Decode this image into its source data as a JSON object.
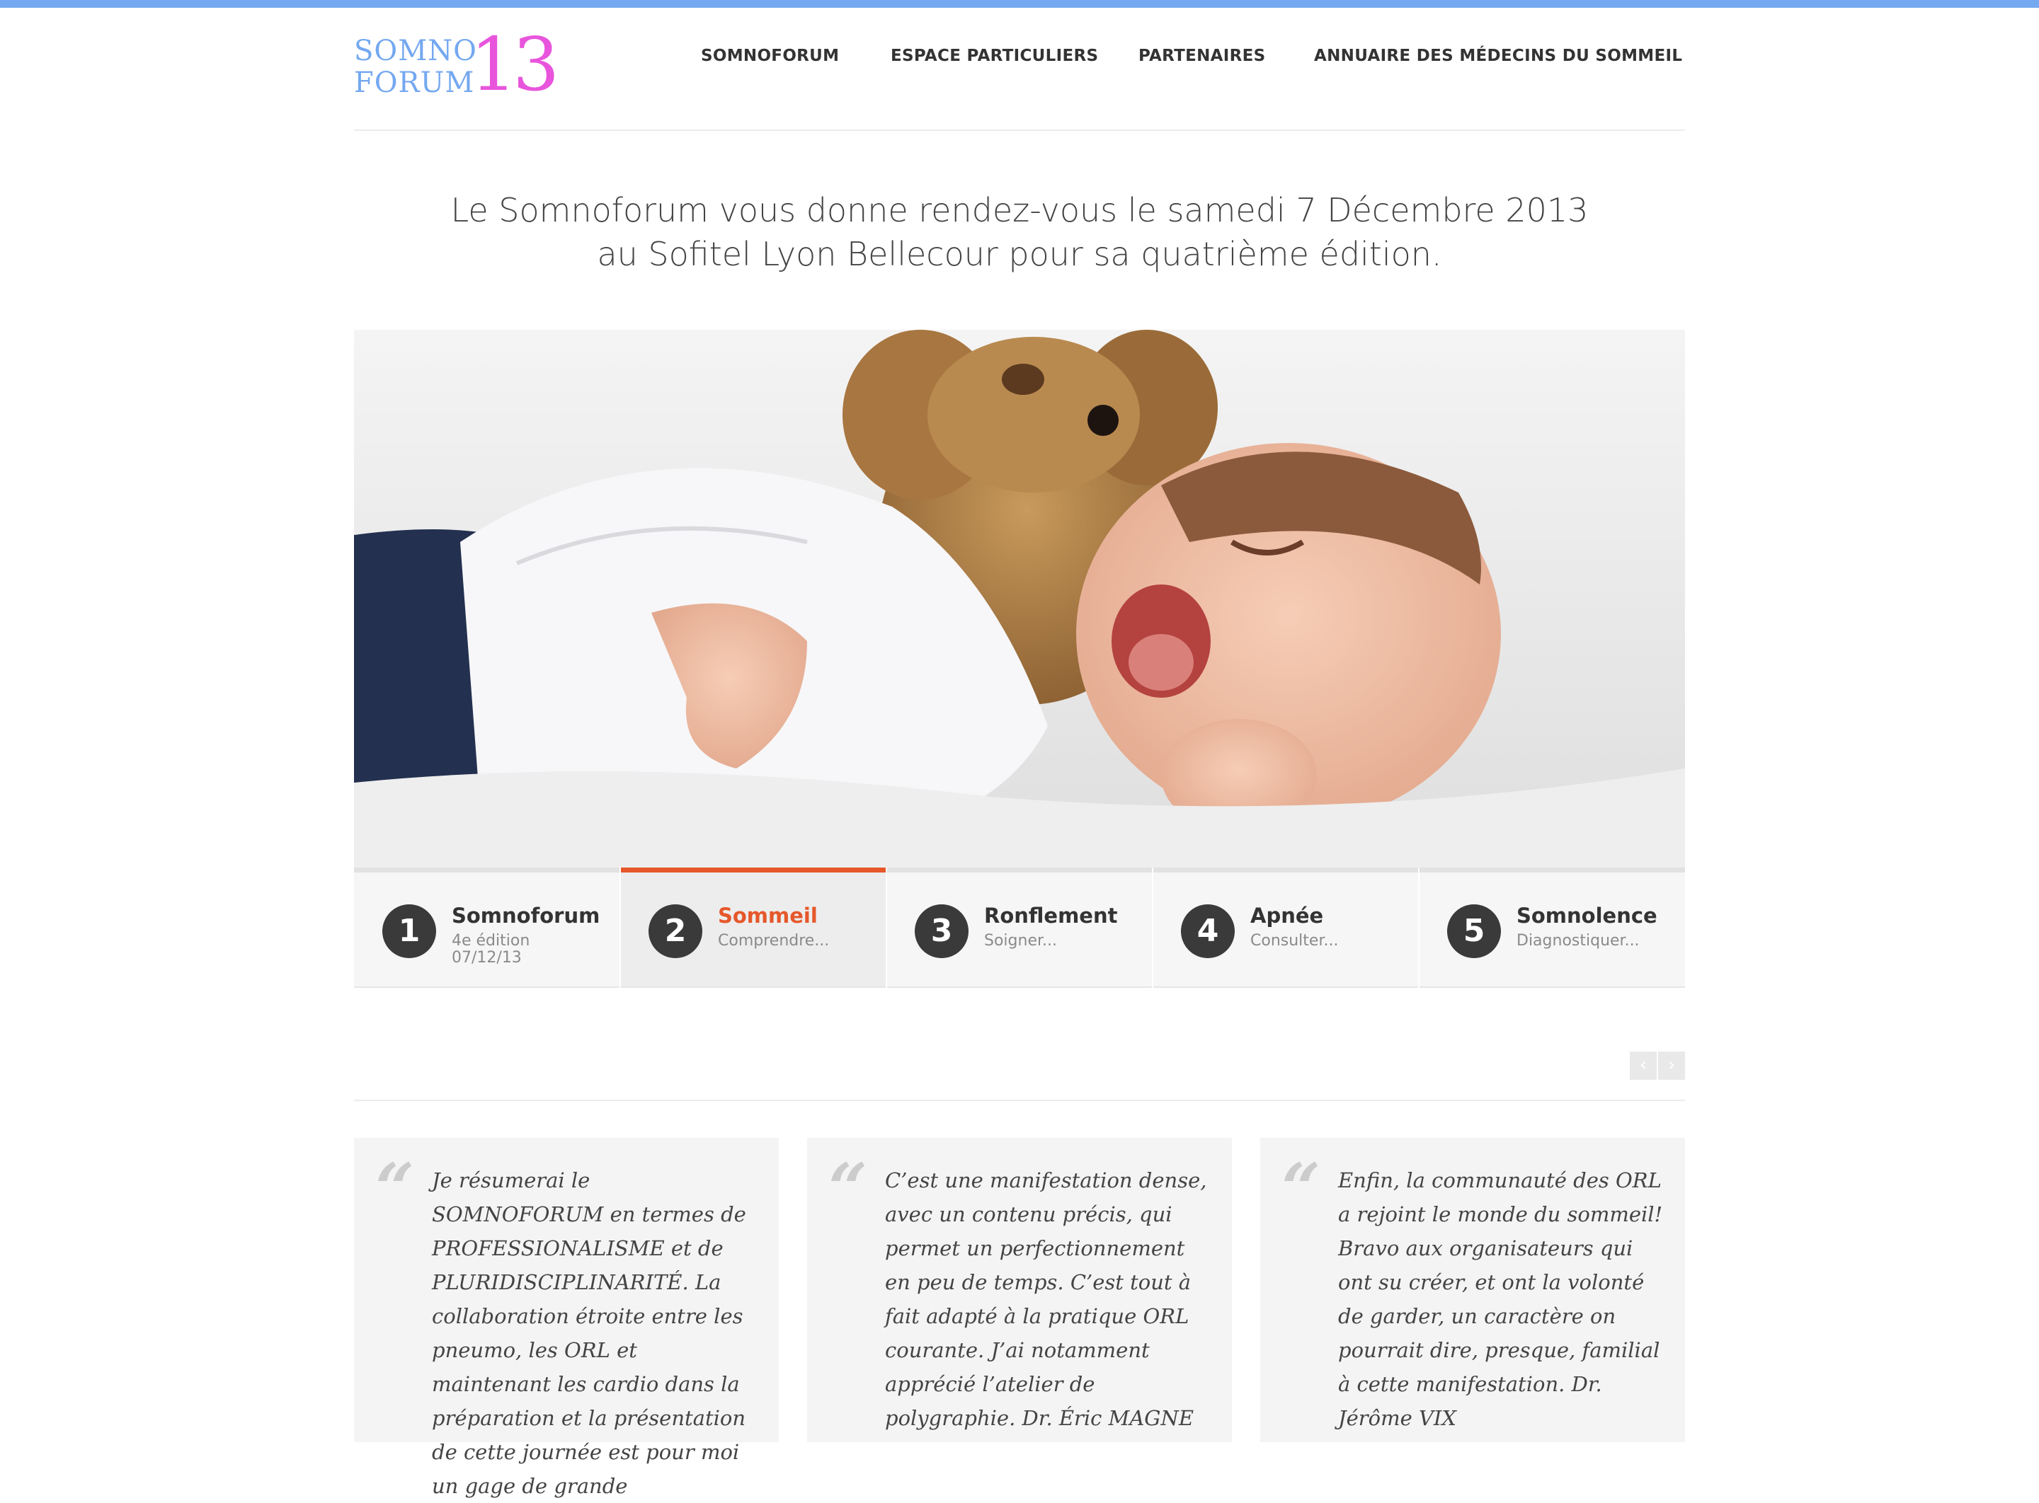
{
  "brand": {
    "logo_text_top": "SOMNO",
    "logo_text_bottom": "FORUM",
    "logo_number": "13",
    "colors": {
      "topbar": "#74a8f0",
      "logo_blue": "#74a8f0",
      "logo_pink": "#e855dc",
      "accent": "#e6572a"
    }
  },
  "nav": {
    "items": [
      {
        "label": "SOMNOFORUM"
      },
      {
        "label": "ESPACE PARTICULIERS"
      },
      {
        "label": "PARTENAIRES"
      },
      {
        "label": "ANNUAIRE DES MÉDECINS DU SOMMEIL"
      }
    ]
  },
  "headline": {
    "line1": "Le Somnoforum vous donne rendez-vous le samedi 7 Décembre 2013",
    "line2": "au Sofitel Lyon Bellecour pour sa quatrième édition."
  },
  "slider": {
    "tabs": [
      {
        "num": "1",
        "title": "Somnoforum",
        "sub1": "4e édition",
        "sub2": "07/12/13",
        "active": false
      },
      {
        "num": "2",
        "title": "Sommeil",
        "sub1": "Comprendre...",
        "sub2": "",
        "active": true
      },
      {
        "num": "3",
        "title": "Ronflement",
        "sub1": "Soigner...",
        "sub2": "",
        "active": false
      },
      {
        "num": "4",
        "title": "Apnée",
        "sub1": "Consulter...",
        "sub2": "",
        "active": false
      },
      {
        "num": "5",
        "title": "Somnolence",
        "sub1": "Diagnostiquer...",
        "sub2": "",
        "active": false
      }
    ],
    "prev_icon": "chevron-left-icon",
    "next_icon": "chevron-right-icon"
  },
  "testimonials": [
    {
      "text": "Je résumerai le SOMNOFORUM en termes de PROFESSIONALISME et de PLURIDISCIPLINARITÉ. La collaboration étroite entre les pneumo, les ORL et maintenant les cardio dans la préparation et la présentation de cette journée est pour moi un gage de grande"
    },
    {
      "text": "C’est une manifestation dense, avec un contenu précis, qui permet un perfectionnement en peu de temps. C’est tout à fait adapté à la pratique ORL courante. J’ai notamment apprécié l’atelier de polygraphie. Dr. Éric MAGNE"
    },
    {
      "text": "Enfin, la communauté des ORL a rejoint le monde du sommeil! Bravo aux organisateurs qui ont su créer, et ont la volonté de garder, un caractère on pourrait dire, presque, familial à cette manifestation. Dr. Jérôme VIX"
    }
  ]
}
